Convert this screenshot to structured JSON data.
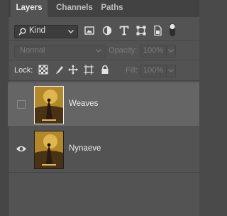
{
  "tabs": [
    {
      "label": "Layers",
      "active": true
    },
    {
      "label": "Channels",
      "active": false
    },
    {
      "label": "Paths",
      "active": false
    }
  ],
  "filter": {
    "kind_label": "Kind",
    "icons": [
      "search-icon",
      "pixel-filter-icon",
      "adjustment-filter-icon",
      "type-filter-icon",
      "shape-filter-icon",
      "smart-object-filter-icon",
      "filter-toggle-icon"
    ]
  },
  "blend": {
    "mode": "Normal",
    "opacity_label": "Opacity:",
    "opacity_value": "100%"
  },
  "lock": {
    "label": "Lock:",
    "fill_label": "Fill:",
    "fill_value": "100%",
    "icons": [
      "lock-transparent-pixels-icon",
      "lock-image-pixels-icon",
      "lock-position-icon",
      "artboard-autonest-icon",
      "lock-all-icon"
    ]
  },
  "layers": [
    {
      "name": "Weaves",
      "visible": false,
      "selected": true
    },
    {
      "name": "Nynaeve",
      "visible": true,
      "selected": false
    }
  ],
  "colors": {
    "panel": "#535353",
    "selected_row": "#656565",
    "tabbar": "#424242"
  }
}
